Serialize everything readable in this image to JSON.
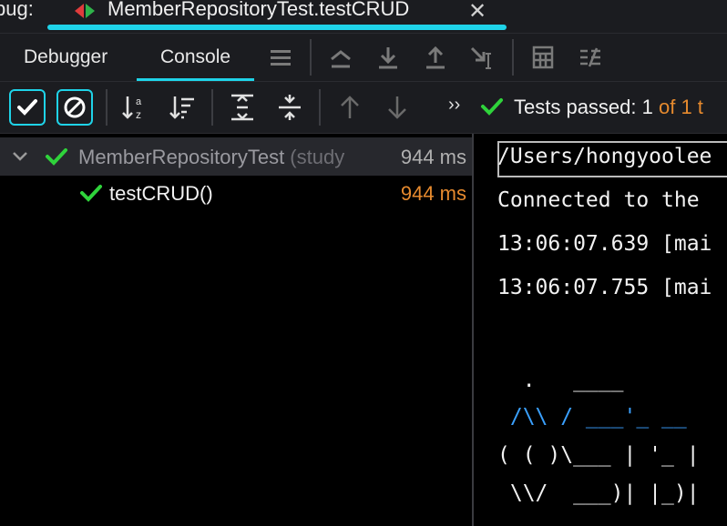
{
  "titlebar": {
    "debug_label": "bug:",
    "run_tab_title": "MemberRepositoryTest.testCRUD",
    "close_glyph": "✕",
    "accent": "#1fd3e8"
  },
  "tabs": {
    "debugger": "Debugger",
    "console": "Console"
  },
  "test_toolbar": {
    "status_label": "Tests passed: ",
    "status_passed": "1",
    "status_of": " of 1 t",
    "more_glyph": "››"
  },
  "tree": {
    "suite_name": "MemberRepositoryTest",
    "suite_hint": " (study",
    "suite_time": "944 ms",
    "test_name": "testCRUD()",
    "test_time": "944 ms",
    "colors": {
      "pass": "#2fd33b",
      "time_orange": "#e68a2e"
    }
  },
  "console": {
    "lines": [
      "/Users/hongyoolee",
      "Connected to the",
      "13:06:07.639 [mai",
      "13:06:07.755 [mai",
      "",
      "  .   ____",
      " /\\\\ / ___'_ __",
      "( ( )\\___ | '_ |",
      " \\\\/  ___)| |_)|"
    ]
  },
  "icons": [
    "debug-run-tab-icon",
    "close-icon",
    "threads-icon",
    "step-over-icon",
    "step-into-icon",
    "step-out-icon",
    "run-to-cursor-icon",
    "evaluate-icon",
    "trace-icon",
    "show-passed-icon",
    "show-ignored-icon",
    "sort-alpha-icon",
    "sort-duration-icon",
    "expand-all-icon",
    "collapse-all-icon",
    "prev-failed-icon",
    "next-failed-icon",
    "check-icon"
  ]
}
